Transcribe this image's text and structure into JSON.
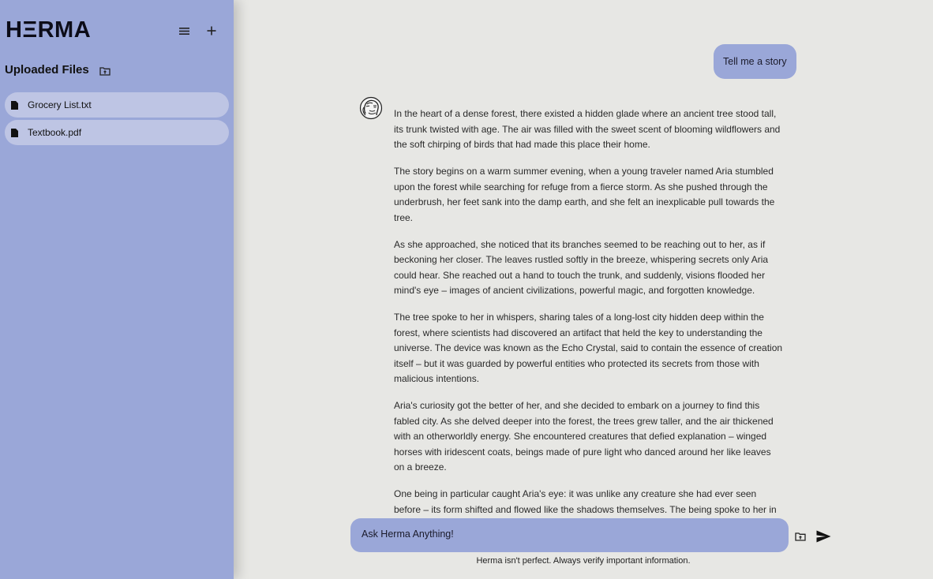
{
  "sidebar": {
    "logo": "HΞRMA",
    "menu_icon": "menu-icon",
    "add_icon": "plus-icon",
    "files_title": "Uploaded Files",
    "upload_icon": "folder-upload-icon",
    "files": [
      {
        "name": "Grocery List.txt",
        "icon": "file-icon"
      },
      {
        "name": "Textbook.pdf",
        "icon": "file-icon"
      }
    ]
  },
  "chat": {
    "user_message": "Tell me a story",
    "assistant_paragraphs": [
      "In the heart of a dense forest, there existed a hidden glade where an ancient tree stood tall, its trunk twisted with age. The air was filled with the sweet scent of blooming wildflowers and the soft chirping of birds that had made this place their home.",
      "The story begins on a warm summer evening, when a young traveler named Aria stumbled upon the forest while searching for refuge from a fierce storm. As she pushed through the underbrush, her feet sank into the damp earth, and she felt an inexplicable pull towards the tree.",
      "As she approached, she noticed that its branches seemed to be reaching out to her, as if beckoning her closer. The leaves rustled softly in the breeze, whispering secrets only Aria could hear. She reached out a hand to touch the trunk, and suddenly, visions flooded her mind's eye – images of ancient civilizations, powerful magic, and forgotten knowledge.",
      "The tree spoke to her in whispers, sharing tales of a long-lost city hidden deep within the forest, where scientists had discovered an artifact that held the key to understanding the universe. The device was known as the Echo Crystal, said to contain the essence of creation itself – but it was guarded by powerful entities who protected its secrets from those with malicious intentions.",
      "Aria's curiosity got the better of her, and she decided to embark on a journey to find this fabled city. As she delved deeper into the forest, the trees grew taller, and the air thickened with an otherworldly energy. She encountered creatures that defied explanation – winged horses with iridescent coats, beings made of pure light who danced around her like leaves on a breeze.",
      "One being in particular caught Aria's eye: it was unlike any creature she had ever seen before – its form shifted and flowed like the shadows themselves. The being spoke to her in"
    ]
  },
  "composer": {
    "placeholder": "Ask Herma Anything!",
    "attach_icon": "folder-upload-icon",
    "send_icon": "send-icon"
  },
  "footer": {
    "disclaimer": "Herma isn't perfect. Always verify important information."
  },
  "colors": {
    "sidebar": "#9aa7d8",
    "file_item": "#bec5e4",
    "main_bg": "#e7e7e4",
    "bubble": "#9aa7d8"
  }
}
